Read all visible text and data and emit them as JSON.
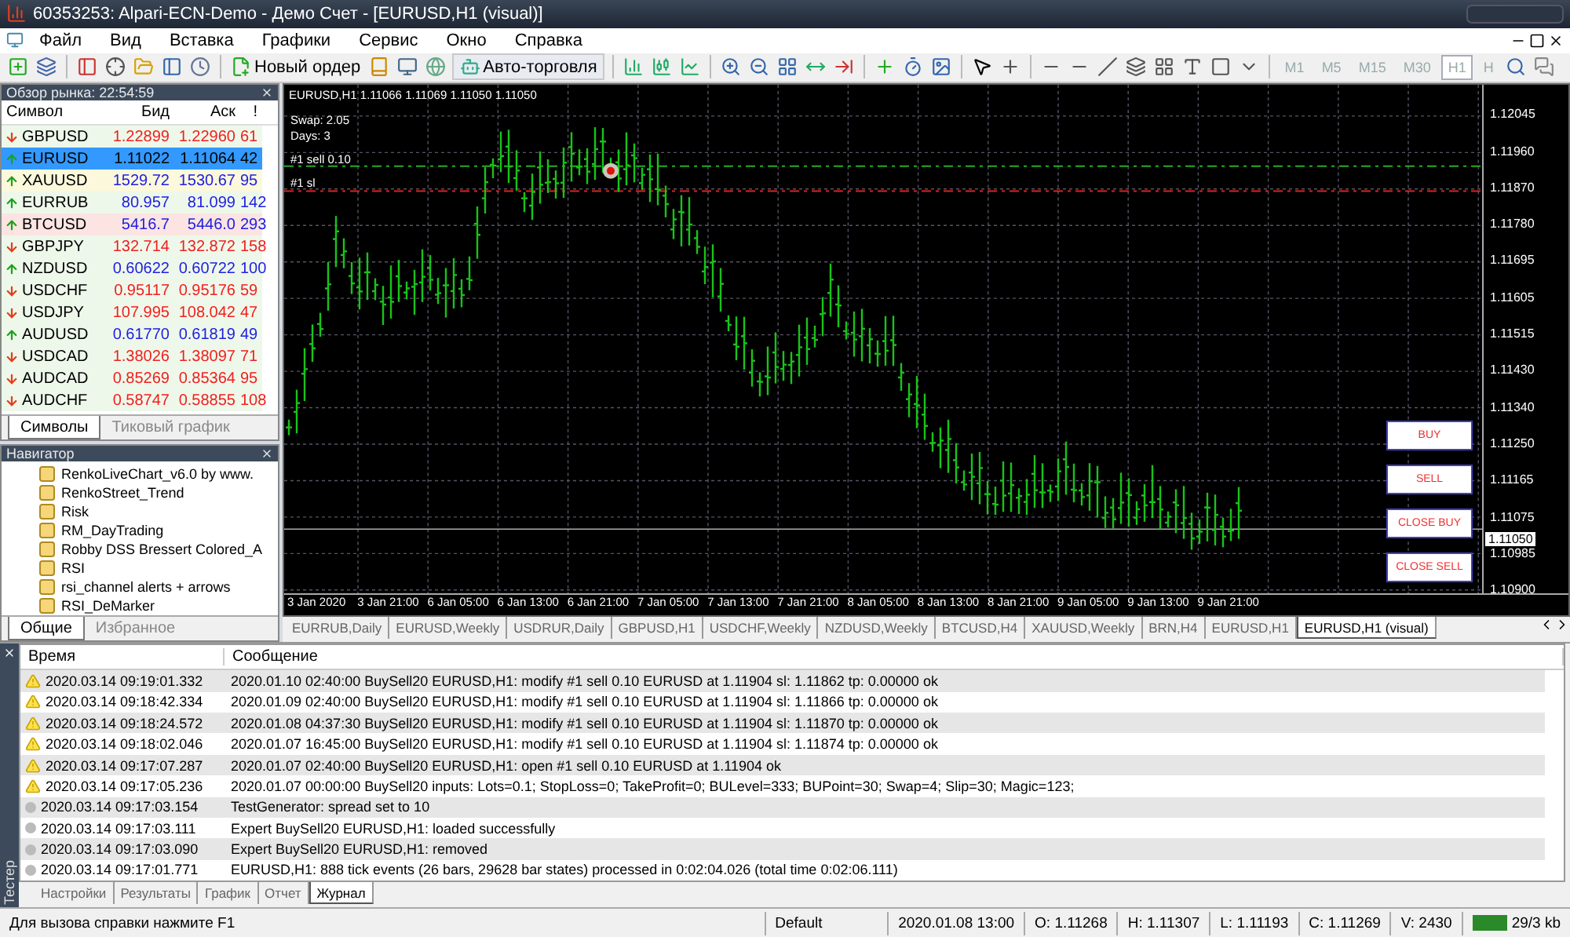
{
  "window": {
    "title": "60353253: Alpari-ECN-Demo - Демо Счет - [EURUSD,H1 (visual)]"
  },
  "menu": [
    "Файл",
    "Вид",
    "Вставка",
    "Графики",
    "Сервис",
    "Окно",
    "Справка"
  ],
  "toolbar": {
    "new_order": "Новый ордер",
    "auto_trading": "Авто-торговля",
    "timeframes": [
      {
        "label": "M1",
        "selected": false
      },
      {
        "label": "M5",
        "selected": false
      },
      {
        "label": "M15",
        "selected": false
      },
      {
        "label": "M30",
        "selected": false
      },
      {
        "label": "H1",
        "selected": true
      },
      {
        "label": "H",
        "selected": false
      }
    ]
  },
  "market_watch": {
    "title": "Обзор рынка: 22:54:59",
    "columns": [
      "Символ",
      "Бид",
      "Аск",
      "!"
    ],
    "rows": [
      {
        "symbol": "GBPUSD",
        "bid": "1.22899",
        "ask": "1.22960",
        "spread": "61",
        "rising": false,
        "color": "#eef8ea",
        "selected": false
      },
      {
        "symbol": "EURUSD",
        "bid": "1.11022",
        "ask": "1.11064",
        "spread": "42",
        "rising": true,
        "selected": true
      },
      {
        "symbol": "XAUUSD",
        "bid": "1529.72",
        "ask": "1530.67",
        "spread": "95",
        "rising": true,
        "color": "#fbf8dc",
        "selected": false
      },
      {
        "symbol": "EURRUB",
        "bid": "80.957",
        "ask": "81.099",
        "spread": "142",
        "rising": true,
        "color": "#eef8ea",
        "selected": false
      },
      {
        "symbol": "BTCUSD",
        "bid": "5416.7",
        "ask": "5446.0",
        "spread": "293",
        "rising": true,
        "color": "#fbe4e2",
        "selected": false
      },
      {
        "symbol": "GBPJPY",
        "bid": "132.714",
        "ask": "132.872",
        "spread": "158",
        "rising": false,
        "color": "#eef8ea",
        "selected": false
      },
      {
        "symbol": "NZDUSD",
        "bid": "0.60622",
        "ask": "0.60722",
        "spread": "100",
        "rising": true,
        "color": "#eef8ea",
        "selected": false
      },
      {
        "symbol": "USDCHF",
        "bid": "0.95117",
        "ask": "0.95176",
        "spread": "59",
        "rising": false,
        "color": "#eef8ea",
        "selected": false
      },
      {
        "symbol": "USDJPY",
        "bid": "107.995",
        "ask": "108.042",
        "spread": "47",
        "rising": false,
        "color": "#eef8ea",
        "selected": false
      },
      {
        "symbol": "AUDUSD",
        "bid": "0.61770",
        "ask": "0.61819",
        "spread": "49",
        "rising": true,
        "color": "#eef8ea",
        "selected": false
      },
      {
        "symbol": "USDCAD",
        "bid": "1.38026",
        "ask": "1.38097",
        "spread": "71",
        "rising": false,
        "color": "#eef8ea",
        "selected": false
      },
      {
        "symbol": "AUDCAD",
        "bid": "0.85269",
        "ask": "0.85364",
        "spread": "95",
        "rising": false,
        "color": "#eef8ea",
        "selected": false
      },
      {
        "symbol": "AUDCHF",
        "bid": "0.58747",
        "ask": "0.58855",
        "spread": "108",
        "rising": false,
        "color": "#eef8ea",
        "selected": false
      }
    ],
    "tabs": [
      {
        "label": "Символы",
        "selected": true
      },
      {
        "label": "Тиковый график",
        "selected": false
      }
    ]
  },
  "navigator": {
    "title": "Навигатор",
    "items": [
      "RenkoLiveChart_v6.0 by www.",
      "RenkoStreet_Trend",
      "Risk",
      "RM_DayTrading",
      "Robby DSS Bressert Colored_A",
      "RSI",
      "rsi_channel alerts + arrows",
      "RSI_DeMarker"
    ],
    "tabs": [
      {
        "label": "Общие",
        "selected": true
      },
      {
        "label": "Избранное",
        "selected": false
      }
    ]
  },
  "chart": {
    "header": "EURUSD,H1  1.11066 1.11069 1.11050 1.11050",
    "info": [
      "Swap: 2.05",
      "Days: 3"
    ],
    "order_label": "#1 sell 0.10",
    "sl_label": "#1 sl",
    "price_ticks": [
      "1.12045",
      "1.11960",
      "1.11870",
      "1.11780",
      "1.11695",
      "1.11605",
      "1.11515",
      "1.11430",
      "1.11340",
      "1.11250",
      "1.11165",
      "1.11075",
      "1.10985",
      "1.10900"
    ],
    "current_price": "1.11050",
    "date_ticks": [
      "3 Jan 2020",
      "3 Jan 21:00",
      "6 Jan 05:00",
      "6 Jan 13:00",
      "6 Jan 21:00",
      "7 Jan 05:00",
      "7 Jan 13:00",
      "7 Jan 21:00",
      "8 Jan 05:00",
      "8 Jan 13:00",
      "8 Jan 21:00",
      "9 Jan 05:00",
      "9 Jan 13:00",
      "9 Jan 21:00"
    ],
    "buttons": [
      "BUY",
      "SELL",
      "CLOSE BUY",
      "CLOSE SELL"
    ]
  },
  "chart_tabs": [
    {
      "label": "EURRUB,Daily",
      "selected": false
    },
    {
      "label": "EURUSD,Weekly",
      "selected": false
    },
    {
      "label": "USDRUR,Daily",
      "selected": false
    },
    {
      "label": "GBPUSD,H1",
      "selected": false
    },
    {
      "label": "USDCHF,Weekly",
      "selected": false
    },
    {
      "label": "NZDUSD,Weekly",
      "selected": false
    },
    {
      "label": "BTCUSD,H4",
      "selected": false
    },
    {
      "label": "XAUUSD,Weekly",
      "selected": false
    },
    {
      "label": "BRN,H4",
      "selected": false
    },
    {
      "label": "EURUSD,H1",
      "selected": false
    },
    {
      "label": "EURUSD,H1 (visual)",
      "selected": true
    }
  ],
  "tester": {
    "title": "Тестер",
    "columns": [
      "Время",
      "Сообщение"
    ],
    "rows": [
      {
        "kind": "warning",
        "time": "2020.03.14 09:19:01.332",
        "message": "2020.01.10 02:40:00  BuySell20 EURUSD,H1: modify #1 sell 0.10 EURUSD at 1.11904 sl: 1.11862 tp: 0.00000 ok"
      },
      {
        "kind": "warning",
        "time": "2020.03.14 09:18:42.334",
        "message": "2020.01.09 02:40:00  BuySell20 EURUSD,H1: modify #1 sell 0.10 EURUSD at 1.11904 sl: 1.11866 tp: 0.00000 ok"
      },
      {
        "kind": "warning",
        "time": "2020.03.14 09:18:24.572",
        "message": "2020.01.08 04:37:30  BuySell20 EURUSD,H1: modify #1 sell 0.10 EURUSD at 1.11904 sl: 1.11870 tp: 0.00000 ok"
      },
      {
        "kind": "warning",
        "time": "2020.03.14 09:18:02.046",
        "message": "2020.01.07 16:45:00  BuySell20 EURUSD,H1: modify #1 sell 0.10 EURUSD at 1.11904 sl: 1.11874 tp: 0.00000 ok"
      },
      {
        "kind": "warning",
        "time": "2020.03.14 09:17:07.287",
        "message": "2020.01.07 02:40:00  BuySell20 EURUSD,H1: open #1 sell 0.10 EURUSD at 1.11904 ok"
      },
      {
        "kind": "warning",
        "time": "2020.03.14 09:17:05.236",
        "message": "2020.01.07 00:00:00  BuySell20 inputs: Lots=0.1; StopLoss=0; TakeProfit=0; BULevel=333; BUPoint=30; Swap=4; Slip=30; Magic=123;"
      },
      {
        "kind": "info",
        "time": "2020.03.14 09:17:03.154",
        "message": "TestGenerator: spread set to 10"
      },
      {
        "kind": "info",
        "time": "2020.03.14 09:17:03.111",
        "message": "Expert BuySell20 EURUSD,H1: loaded successfully"
      },
      {
        "kind": "info",
        "time": "2020.03.14 09:17:03.090",
        "message": "Expert BuySell20 EURUSD,H1: removed"
      },
      {
        "kind": "info",
        "time": "2020.03.14 09:17:01.771",
        "message": "EURUSD,H1: 888 tick events (26 bars, 29628 bar states) processed in 0:02:04.026 (total time 0:02:06.111)"
      }
    ],
    "tabs": [
      {
        "label": "Настройки",
        "selected": false
      },
      {
        "label": "Результаты",
        "selected": false
      },
      {
        "label": "График",
        "selected": false
      },
      {
        "label": "Отчет",
        "selected": false
      },
      {
        "label": "Журнал",
        "selected": true
      }
    ]
  },
  "status_bar": {
    "help": "Для вызова справки нажмите F1",
    "profile": "Default",
    "date": "2020.01.08 13:00",
    "open": "O: 1.11268",
    "high": "H: 1.11307",
    "low": "L: 1.11193",
    "close": "C: 1.11269",
    "volume": "V: 2430",
    "traffic": "29/3 kb"
  }
}
